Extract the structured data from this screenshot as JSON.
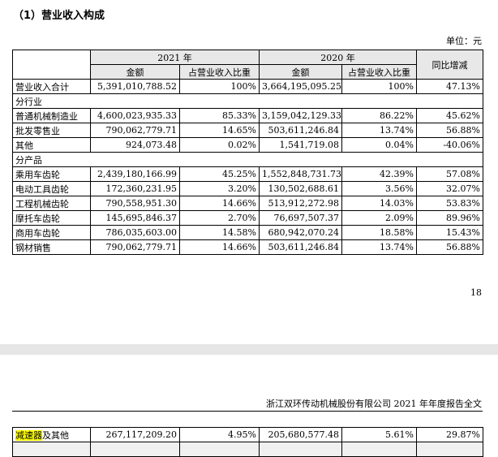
{
  "title": "（1）营业收入构成",
  "unit": "单位：元",
  "header": {
    "year_2021": "2021 年",
    "year_2020": "2020 年",
    "yoy": "同比增减",
    "amount": "金额",
    "ratio": "占营业收入比重"
  },
  "total": {
    "label": "营业收入合计",
    "a2021": "5,391,010,788.52",
    "r2021": "100%",
    "a2020": "3,664,195,095.25",
    "r2020": "100%",
    "yoy": "47.13%"
  },
  "by_industry": {
    "title": "分行业",
    "rows": [
      {
        "label": "普通机械制造业",
        "a2021": "4,600,023,935.33",
        "r2021": "85.33%",
        "a2020": "3,159,042,129.33",
        "r2020": "86.22%",
        "yoy": "45.62%"
      },
      {
        "label": "批发零售业",
        "a2021": "790,062,779.71",
        "r2021": "14.65%",
        "a2020": "503,611,246.84",
        "r2020": "13.74%",
        "yoy": "56.88%"
      },
      {
        "label": "其他",
        "a2021": "924,073.48",
        "r2021": "0.02%",
        "a2020": "1,541,719.08",
        "r2020": "0.04%",
        "yoy": "-40.06%"
      }
    ]
  },
  "by_product": {
    "title": "分产品",
    "rows": [
      {
        "label": "乘用车齿轮",
        "a2021": "2,439,180,166.99",
        "r2021": "45.25%",
        "a2020": "1,552,848,731.73",
        "r2020": "42.39%",
        "yoy": "57.08%"
      },
      {
        "label": "电动工具齿轮",
        "a2021": "172,360,231.95",
        "r2021": "3.20%",
        "a2020": "130,502,688.61",
        "r2020": "3.56%",
        "yoy": "32.07%"
      },
      {
        "label": "工程机械齿轮",
        "a2021": "790,558,951.30",
        "r2021": "14.66%",
        "a2020": "513,912,272.98",
        "r2020": "14.03%",
        "yoy": "53.83%"
      },
      {
        "label": "摩托车齿轮",
        "a2021": "145,695,846.37",
        "r2021": "2.70%",
        "a2020": "76,697,507.37",
        "r2020": "2.09%",
        "yoy": "89.96%"
      },
      {
        "label": "商用车齿轮",
        "a2021": "786,035,603.00",
        "r2021": "14.58%",
        "a2020": "680,942,070.24",
        "r2020": "18.58%",
        "yoy": "15.43%"
      },
      {
        "label": "钢材销售",
        "a2021": "790,062,779.71",
        "r2021": "14.66%",
        "a2020": "503,611,246.84",
        "r2020": "13.74%",
        "yoy": "56.88%"
      }
    ]
  },
  "page_number": "18",
  "footer": "浙江双环传动机械股份有限公司 2021 年年度报告全文",
  "continuation": {
    "label_highlight": "减速器",
    "label_rest": "及其他",
    "a2021": "267,117,209.20",
    "r2021": "4.95%",
    "a2020": "205,680,577.48",
    "r2020": "5.61%",
    "yoy": "29.87%"
  }
}
